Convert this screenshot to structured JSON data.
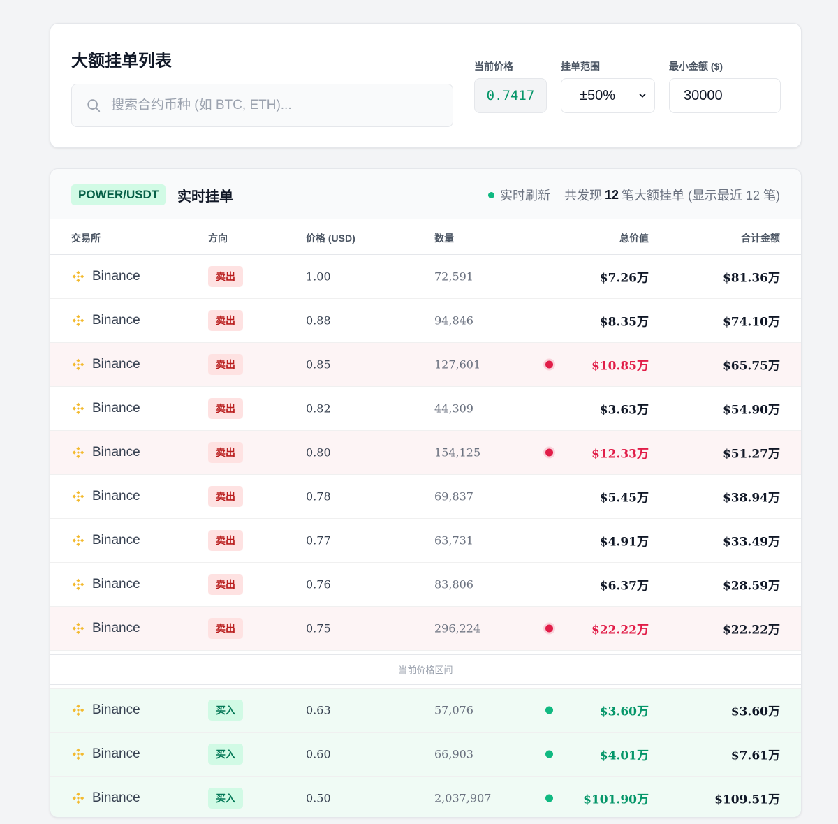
{
  "page": {
    "title": "大额挂单列表",
    "search_placeholder": "搜索合约币种 (如 BTC, ETH)..."
  },
  "filters": {
    "current_price_label": "当前价格",
    "current_price": "0.7417",
    "range_label": "挂单范围",
    "range_value": "±50%",
    "min_amount_label": "最小金额 ($)",
    "min_amount_value": "30000"
  },
  "orders": {
    "pair": "POWER/USDT",
    "title": "实时挂单",
    "live_label": "实时刷新",
    "summary_prefix": "共发现",
    "summary_count": "12",
    "summary_suffix": "笔大额挂单 (显示最近 12 笔)",
    "columns": {
      "exchange": "交易所",
      "direction": "方向",
      "price": "价格 (USD)",
      "quantity": "数量",
      "total": "总价值",
      "cumulative": "合计金额"
    },
    "divider_label": "当前价格区间",
    "sell_rows": [
      {
        "exchange": "Binance",
        "direction": "卖出",
        "price": "1.00",
        "quantity": "72,591",
        "total": "$7.26万",
        "cumulative": "$81.36万",
        "highlight": false
      },
      {
        "exchange": "Binance",
        "direction": "卖出",
        "price": "0.88",
        "quantity": "94,846",
        "total": "$8.35万",
        "cumulative": "$74.10万",
        "highlight": false
      },
      {
        "exchange": "Binance",
        "direction": "卖出",
        "price": "0.85",
        "quantity": "127,601",
        "total": "$10.85万",
        "cumulative": "$65.75万",
        "highlight": true
      },
      {
        "exchange": "Binance",
        "direction": "卖出",
        "price": "0.82",
        "quantity": "44,309",
        "total": "$3.63万",
        "cumulative": "$54.90万",
        "highlight": false
      },
      {
        "exchange": "Binance",
        "direction": "卖出",
        "price": "0.80",
        "quantity": "154,125",
        "total": "$12.33万",
        "cumulative": "$51.27万",
        "highlight": true
      },
      {
        "exchange": "Binance",
        "direction": "卖出",
        "price": "0.78",
        "quantity": "69,837",
        "total": "$5.45万",
        "cumulative": "$38.94万",
        "highlight": false
      },
      {
        "exchange": "Binance",
        "direction": "卖出",
        "price": "0.77",
        "quantity": "63,731",
        "total": "$4.91万",
        "cumulative": "$33.49万",
        "highlight": false
      },
      {
        "exchange": "Binance",
        "direction": "卖出",
        "price": "0.76",
        "quantity": "83,806",
        "total": "$6.37万",
        "cumulative": "$28.59万",
        "highlight": false
      },
      {
        "exchange": "Binance",
        "direction": "卖出",
        "price": "0.75",
        "quantity": "296,224",
        "total": "$22.22万",
        "cumulative": "$22.22万",
        "highlight": true
      }
    ],
    "buy_rows": [
      {
        "exchange": "Binance",
        "direction": "买入",
        "price": "0.63",
        "quantity": "57,076",
        "total": "$3.60万",
        "cumulative": "$3.60万",
        "highlight": true
      },
      {
        "exchange": "Binance",
        "direction": "买入",
        "price": "0.60",
        "quantity": "66,903",
        "total": "$4.01万",
        "cumulative": "$7.61万",
        "highlight": true
      },
      {
        "exchange": "Binance",
        "direction": "买入",
        "price": "0.50",
        "quantity": "2,037,907",
        "total": "$101.90万",
        "cumulative": "$109.51万",
        "highlight": true
      }
    ]
  },
  "colors": {
    "sell": "#e11d48",
    "buy": "#059669",
    "binance": "#f3ba2f"
  }
}
